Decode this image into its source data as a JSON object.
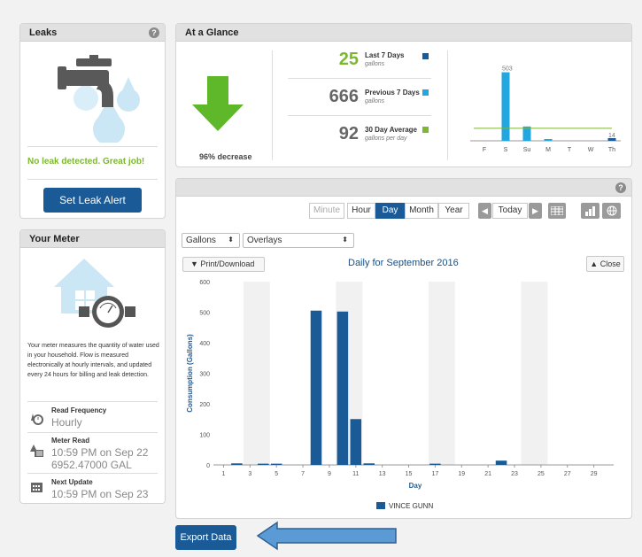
{
  "leaks": {
    "title": "Leaks",
    "help": "?",
    "status": "No leak detected. Great job!",
    "alert_button": "Set Leak Alert",
    "colors": {
      "status": "#7cb82f"
    }
  },
  "meter": {
    "title": "Your Meter",
    "description": "Your meter measures the quantity of water used in your household. Flow is measured electronically at hourly intervals, and updated every 24 hours for billing and leak detection.",
    "read_frequency_label": "Read Frequency",
    "read_frequency_value": "Hourly",
    "meter_read_label": "Meter Read",
    "meter_read_time": "10:59 PM on Sep 22",
    "meter_read_value": "6952.47000 GAL",
    "next_update_label": "Next Update",
    "next_update_value": "10:59 PM on Sep 23"
  },
  "glance": {
    "title": "At a Glance",
    "decrease_text": "96% decrease",
    "stats": [
      {
        "value": "25",
        "label": "Last 7 Days",
        "unit": "gallons",
        "color": "#7cb82f",
        "swatch": "#1a5a96"
      },
      {
        "value": "666",
        "label": "Previous 7 Days",
        "unit": "gallons",
        "color": "#666666",
        "swatch": "#22a7e0"
      },
      {
        "value": "92",
        "label": "30 Day Average",
        "unit": "gallons per day",
        "color": "#666666",
        "swatch": "#7cb82f"
      }
    ],
    "mini_chart": {
      "type": "bar",
      "categories": [
        "F",
        "S",
        "Su",
        "M",
        "T",
        "W",
        "Th"
      ],
      "values": [
        0,
        503,
        105,
        4,
        0,
        0,
        14
      ],
      "labels": [
        "",
        "503",
        "",
        "",
        "",
        "",
        "14"
      ],
      "average": 92,
      "ymax": 520
    }
  },
  "toolbar": {
    "minute": "Minute",
    "hour": "Hour",
    "day": "Day",
    "month": "Month",
    "year": "Year",
    "today": "Today",
    "prev": "◀",
    "next": "▶"
  },
  "selects": {
    "units": "Gallons",
    "overlays": "Overlays"
  },
  "chart_header": {
    "print_label": "▼  Print/Download",
    "title": "Daily for September 2016",
    "close_label": "▲ Close"
  },
  "chart_data": {
    "type": "bar",
    "title": "Daily for September 2016",
    "xlabel": "Day",
    "ylabel": "Consumption (Gallons)",
    "ylim": [
      0,
      600
    ],
    "yticks": [
      0,
      100,
      200,
      300,
      400,
      500,
      600
    ],
    "xticks": [
      1,
      3,
      5,
      7,
      9,
      11,
      13,
      15,
      17,
      19,
      21,
      23,
      25,
      27,
      29
    ],
    "weekend_days": [
      [
        3,
        4
      ],
      [
        10,
        11
      ],
      [
        17,
        18
      ],
      [
        24,
        25
      ]
    ],
    "x": [
      2,
      4,
      5,
      8,
      10,
      11,
      12,
      17,
      22
    ],
    "values": [
      5,
      4,
      4,
      505,
      502,
      150,
      5,
      4,
      14
    ],
    "series_color": "#1a5a96",
    "legend": "VINCE GUNN",
    "grid": false
  },
  "export_button": "Export Data"
}
